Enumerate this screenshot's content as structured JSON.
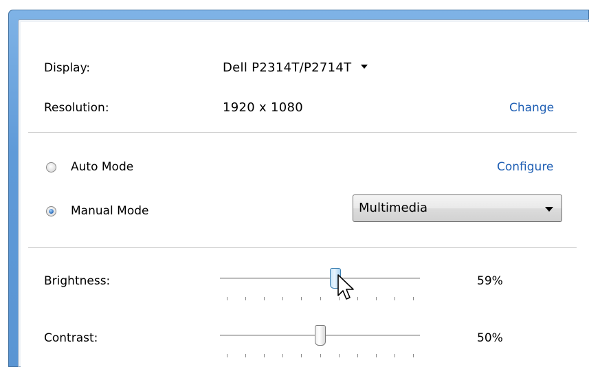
{
  "display": {
    "label": "Display:",
    "value": "Dell P2314T/P2714T"
  },
  "resolution": {
    "label": "Resolution:",
    "value": "1920 x 1080",
    "link": "Change"
  },
  "modes": {
    "auto_label": "Auto Mode",
    "configure_link": "Configure",
    "manual_label": "Manual Mode",
    "selected": "Manual Mode",
    "preset_value": "Multimedia"
  },
  "brightness": {
    "label": "Brightness:",
    "value_text": "59%",
    "value": 59
  },
  "contrast": {
    "label": "Contrast:",
    "value_text": "50%",
    "value": 50
  },
  "colors": {
    "link": "#1f5fb4",
    "frame": "#5f9ad8"
  },
  "icons": {
    "dropdown": "chevron-down-icon",
    "cursor": "mouse-pointer-icon"
  }
}
